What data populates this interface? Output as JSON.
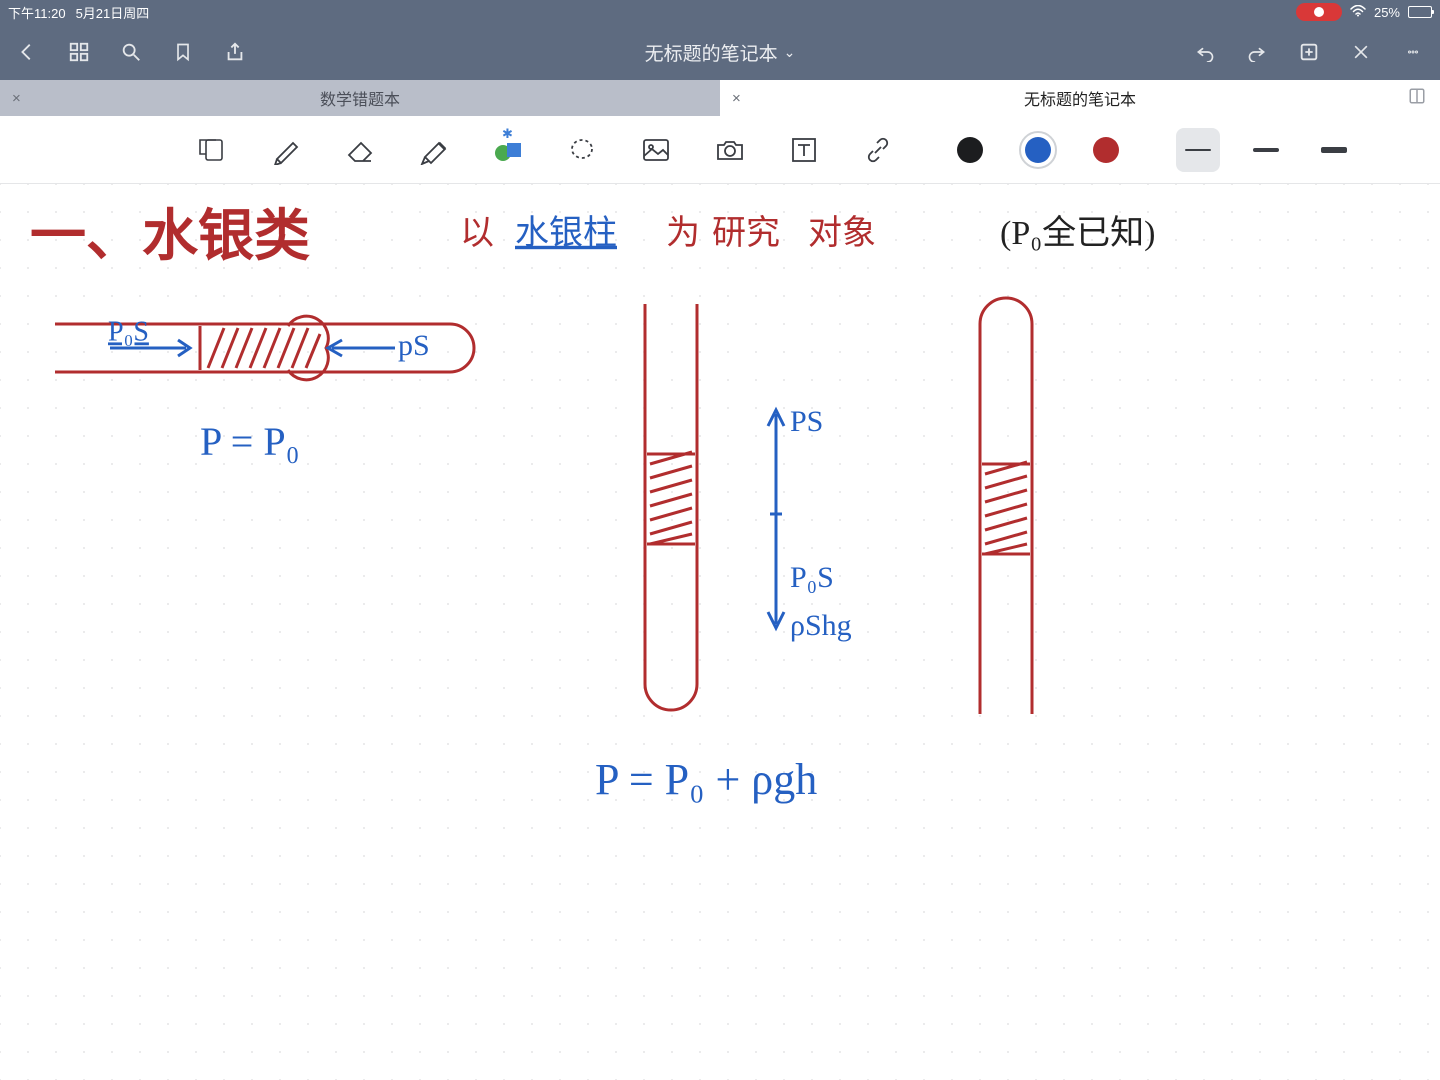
{
  "status": {
    "time": "下午11:20",
    "date": "5月21日周四",
    "battery_pct": "25%"
  },
  "header": {
    "title": "无标题的笔记本",
    "chevron": "⌄"
  },
  "tabs": {
    "inactive": {
      "label": "数学错题本",
      "close": "×"
    },
    "active": {
      "label": "无标题的笔记本",
      "close": "×"
    }
  },
  "toolbar": {
    "colors": {
      "black": "#1c1d1f",
      "blue": "#2560c2",
      "red": "#b12d2e",
      "selected": "blue"
    },
    "stroke_selected": "thin"
  },
  "notes": {
    "title_section": "一、水银类",
    "title_study": "以 水银柱 为 研究 对象",
    "p0_known": "(P₀全已知)",
    "pos_label": "P₀S",
    "ps_label": "pS",
    "eq1": "P = P₀",
    "ps_up": "PS",
    "p0s_down": "P₀S",
    "pshg": "ρShg",
    "eq2": "P = P₀ + ρgh"
  }
}
